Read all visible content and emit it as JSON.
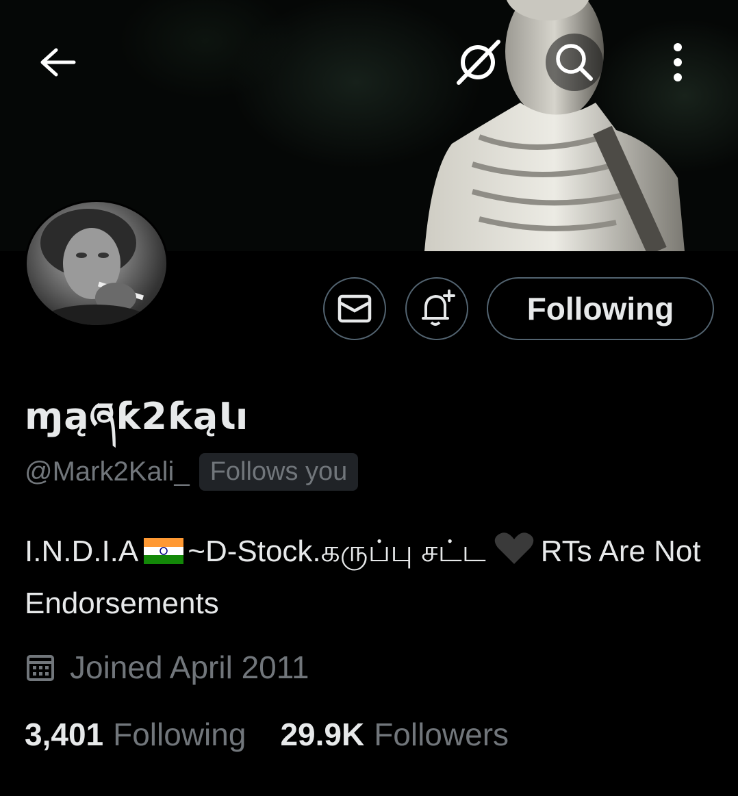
{
  "profile": {
    "display_name": "ɱąཞƙ2ƙąƖı",
    "handle": "@Mark2Kali_",
    "follows_you_badge": "Follows you",
    "bio_part1": "I.N.D.I.A",
    "bio_part2": "~D-Stock.கருப்பு சட்ட",
    "bio_part3": "RTs Are Not Endorsements",
    "joined": "Joined April 2011"
  },
  "actions": {
    "following_label": "Following"
  },
  "stats": {
    "following_count": "3,401",
    "following_label": "Following",
    "followers_count": "29.9K",
    "followers_label": "Followers"
  },
  "icons": {
    "back": "arrow-left-icon",
    "grok": "grok-icon",
    "search": "search-icon",
    "more": "more-vertical-icon",
    "message": "mail-icon",
    "notify": "bell-plus-icon",
    "calendar": "calendar-icon"
  },
  "colors": {
    "background": "#000000",
    "text_primary": "#e7e9ea",
    "text_secondary": "#71767b",
    "border": "#536471"
  }
}
